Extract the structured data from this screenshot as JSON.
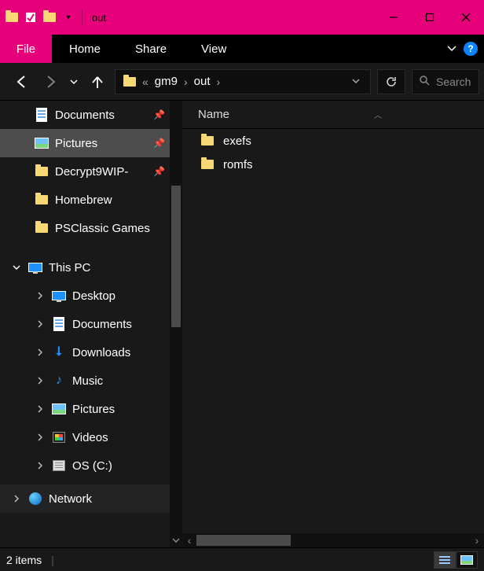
{
  "window": {
    "title": "out"
  },
  "ribbon": {
    "file": "File",
    "tabs": [
      "Home",
      "Share",
      "View"
    ]
  },
  "breadcrumb": {
    "segments": [
      "gm9",
      "out"
    ]
  },
  "search": {
    "placeholder": "Search"
  },
  "sidebar": {
    "quick_access": [
      {
        "label": "Documents",
        "icon": "document",
        "pinned": true
      },
      {
        "label": "Pictures",
        "icon": "pictures",
        "pinned": true,
        "selected": true
      },
      {
        "label": "Decrypt9WIP-",
        "icon": "folder",
        "pinned": true
      },
      {
        "label": "Homebrew",
        "icon": "folder",
        "pinned": false
      },
      {
        "label": "PSClassic Games",
        "icon": "folder",
        "pinned": false
      }
    ],
    "this_pc": {
      "label": "This PC",
      "children": [
        {
          "label": "Desktop",
          "icon": "monitor"
        },
        {
          "label": "Documents",
          "icon": "document"
        },
        {
          "label": "Downloads",
          "icon": "download"
        },
        {
          "label": "Music",
          "icon": "music"
        },
        {
          "label": "Pictures",
          "icon": "pictures"
        },
        {
          "label": "Videos",
          "icon": "video"
        },
        {
          "label": "OS (C:)",
          "icon": "disk"
        }
      ]
    },
    "network": {
      "label": "Network"
    }
  },
  "columns": {
    "name": "Name"
  },
  "files": [
    {
      "name": "exefs",
      "type": "folder"
    },
    {
      "name": "romfs",
      "type": "folder"
    }
  ],
  "status": {
    "item_count": "2 items"
  }
}
